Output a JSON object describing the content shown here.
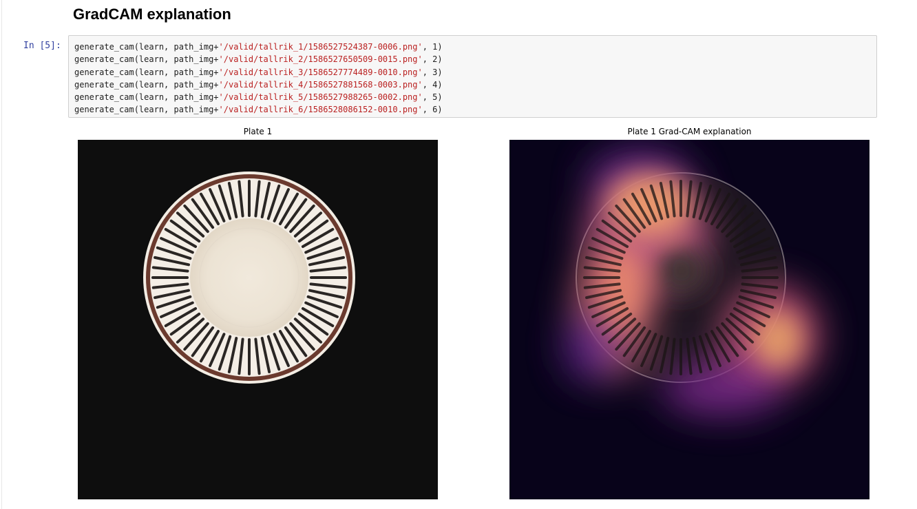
{
  "notebook": {
    "heading": "GradCAM explanation",
    "cell": {
      "prompt": "In [5]:",
      "lines": [
        {
          "pre": "generate_cam(learn, path_img+",
          "str": "'/valid/tallrik_1/1586527524387-0006.png'",
          "post": ", 1)"
        },
        {
          "pre": "generate_cam(learn, path_img+",
          "str": "'/valid/tallrik_2/1586527650509-0015.png'",
          "post": ", 2)"
        },
        {
          "pre": "generate_cam(learn, path_img+",
          "str": "'/valid/tallrik_3/1586527774489-0010.png'",
          "post": ", 3)"
        },
        {
          "pre": "generate_cam(learn, path_img+",
          "str": "'/valid/tallrik_4/1586527881568-0003.png'",
          "post": ", 4)"
        },
        {
          "pre": "generate_cam(learn, path_img+",
          "str": "'/valid/tallrik_5/1586527988265-0002.png'",
          "post": ", 5)"
        },
        {
          "pre": "generate_cam(learn, path_img+",
          "str": "'/valid/tallrik_6/1586528086152-0010.png'",
          "post": ", 6)"
        }
      ]
    },
    "output": {
      "plot_left_title": "Plate 1",
      "plot_right_title": "Plate 1 Grad-CAM explanation"
    }
  },
  "colors": {
    "prompt": "#303f9f",
    "string": "#ba2121",
    "code_bg": "#f7f7f7",
    "photo_bg": "#0d0d0d",
    "plate": "#eee6d9",
    "rim": "#6b3a2e"
  }
}
